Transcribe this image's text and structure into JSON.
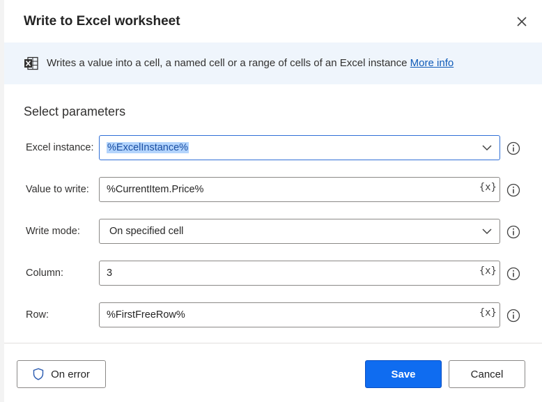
{
  "dialog": {
    "title": "Write to Excel worksheet",
    "description": "Writes a value into a cell, a named cell or a range of cells of an Excel instance",
    "more_info_link": "More info",
    "section_title": "Select parameters"
  },
  "parameters": [
    {
      "label": "Excel instance:",
      "value": "%ExcelInstance%",
      "control": "dropdown",
      "focused": true,
      "text_selected": true
    },
    {
      "label": "Value to write:",
      "value": "%CurrentItem.Price%",
      "control": "text",
      "variable_button": "{x}"
    },
    {
      "label": "Write mode:",
      "value": "On specified cell",
      "control": "dropdown"
    },
    {
      "label": "Column:",
      "value": "3",
      "control": "text",
      "variable_button": "{x}"
    },
    {
      "label": "Row:",
      "value": "%FirstFreeRow%",
      "control": "text",
      "variable_button": "{x}"
    }
  ],
  "footer": {
    "on_error_label": "On error",
    "save_label": "Save",
    "cancel_label": "Cancel"
  },
  "colors": {
    "primary_button": "#0f6cf0",
    "banner_bg": "#eff5fc",
    "link": "#0f5bb8",
    "focus_border": "#2f6fd6",
    "selection_bg": "#b3d4fc"
  },
  "icons": {
    "close": "close-icon",
    "excel": "excel-icon",
    "dropdown": "chevron-down-icon",
    "info": "info-icon",
    "on_error": "shield-icon"
  }
}
